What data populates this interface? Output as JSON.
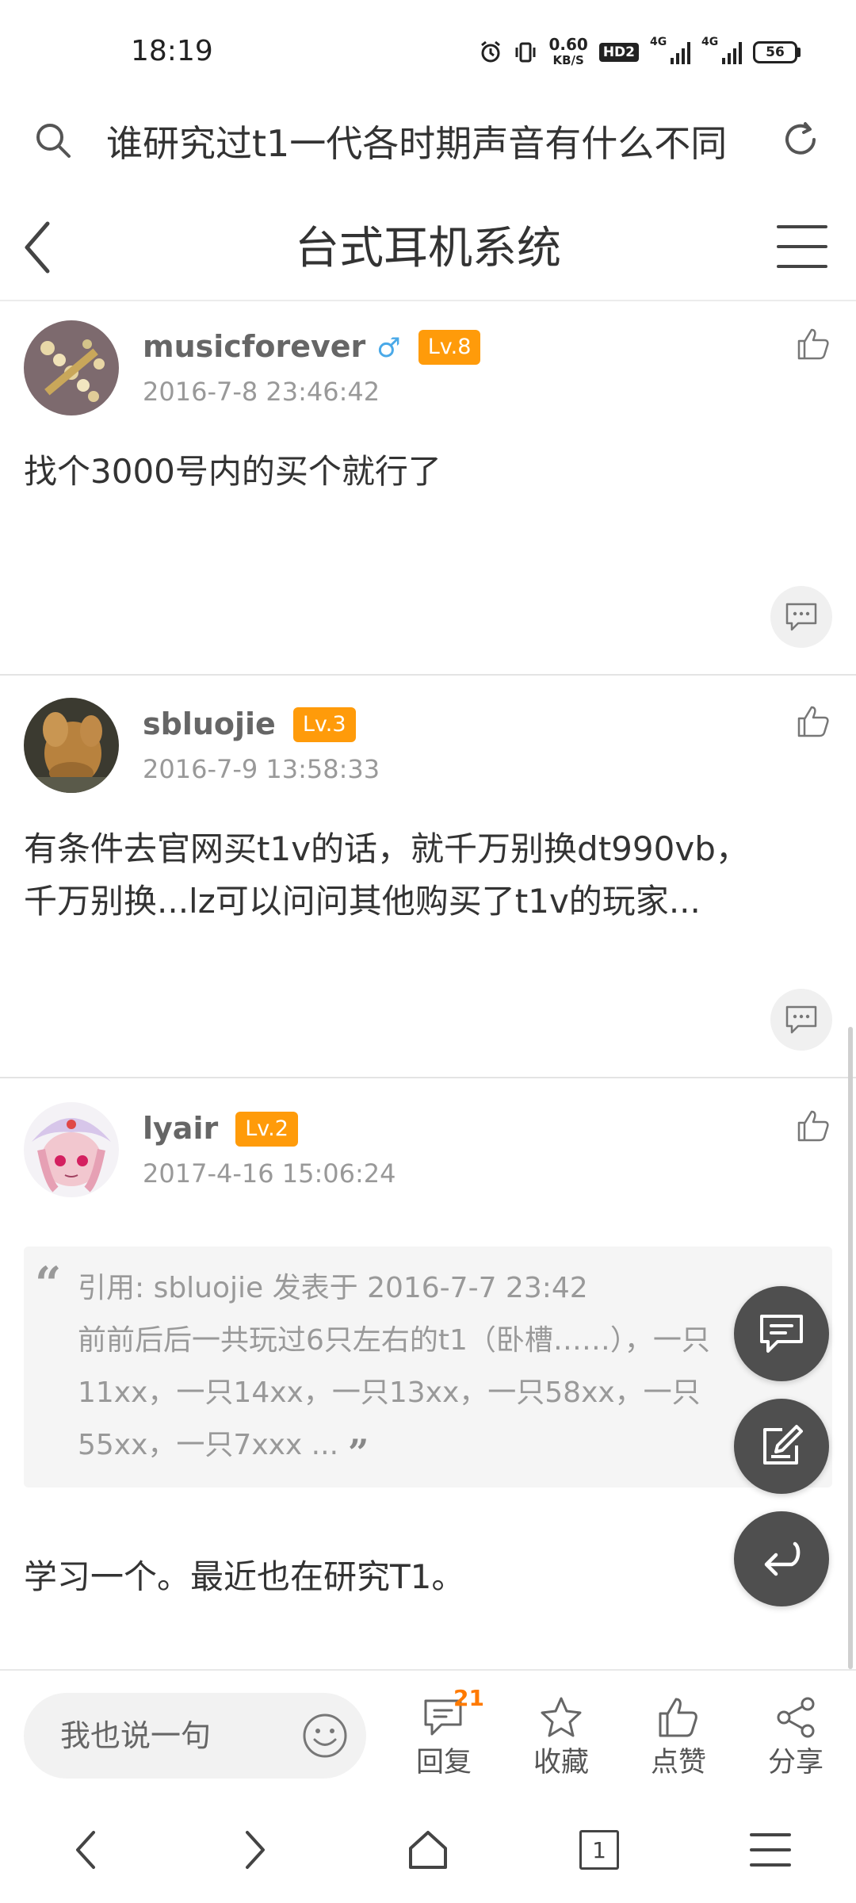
{
  "status_bar": {
    "time": "18:19",
    "net_speed": "0.60",
    "net_unit": "KB/S",
    "hd": "HD2",
    "sig1": "4G",
    "sig2": "4G",
    "battery": "56"
  },
  "url_bar": {
    "text": "谁研究过t1一代各时期声音有什么不同"
  },
  "header": {
    "title": "台式耳机系统"
  },
  "posts": [
    {
      "username": "musicforever",
      "gender": "♂",
      "level": "Lv.8",
      "time": "2016-7-8 23:46:42",
      "content": "找个3000号内的买个就行了"
    },
    {
      "username": "sbluojie",
      "level": "Lv.3",
      "time": "2016-7-9 13:58:33",
      "content_line1": "有条件去官网买t1v的话，就千万别换dt990vb，",
      "content_line2": "千万别换...lz可以问问其他购买了t1v的玩家..."
    },
    {
      "username": "lyair",
      "level": "Lv.2",
      "time": "2017-4-16 15:06:24",
      "quote": {
        "line1": "引用: sbluojie 发表于 2016-7-7 23:42",
        "line2": "前前后后一共玩过6只左右的t1（卧槽……），一只",
        "line3": "11xx，一只14xx，一只13xx，一只58xx，一只",
        "line4": "55xx，一只7xxx ..."
      },
      "content": "学习一个。最近也在研究T1。"
    }
  ],
  "action_bar": {
    "reply_placeholder": "我也说一句",
    "reply_label": "回复",
    "reply_count": "21",
    "favorite_label": "收藏",
    "like_label": "点赞",
    "share_label": "分享"
  },
  "nav_bar": {
    "tab_count": "1"
  },
  "colors": {
    "level_badge": "#ff9b0a",
    "reply_count": "#ff7a00",
    "fab": "#4f4f4f",
    "gender_male": "#4aa9e8"
  }
}
